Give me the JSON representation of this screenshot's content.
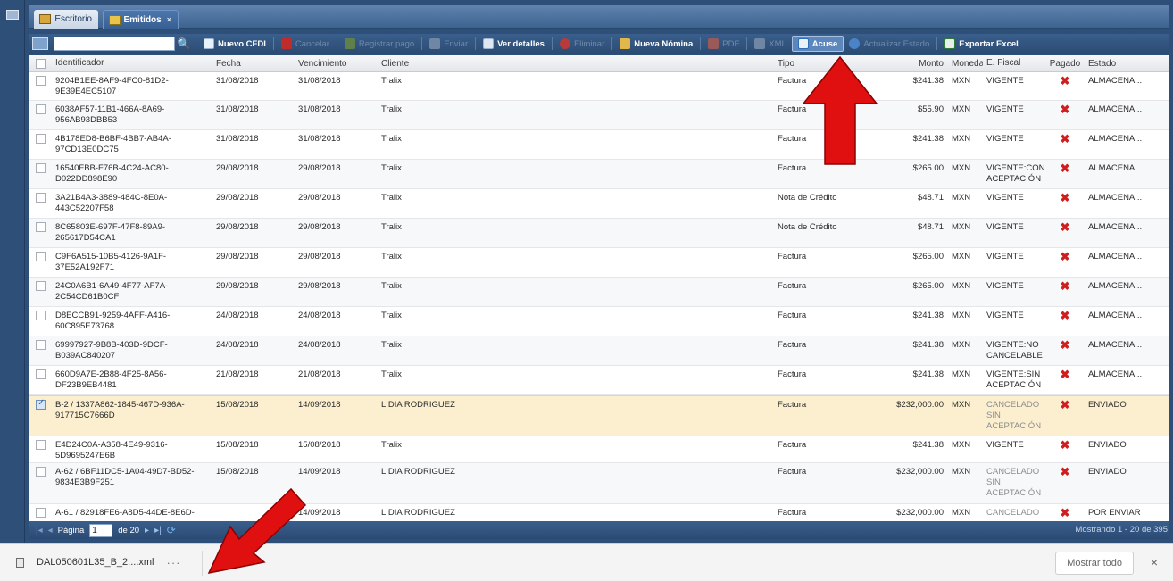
{
  "tabs": [
    {
      "label": "Escritorio",
      "icon": "desktop-icon"
    },
    {
      "label": "Emitidos",
      "icon": "documents-icon",
      "close": "×"
    }
  ],
  "toolbar": {
    "search_placeholder": "",
    "buttons": [
      {
        "label": "Nuevo CFDI",
        "icon": "new-document-icon",
        "enabled": true
      },
      {
        "label": "Cancelar",
        "icon": "cancel-icon",
        "enabled": false
      },
      {
        "label": "Registrar pago",
        "icon": "payment-icon",
        "enabled": false
      },
      {
        "label": "Enviar",
        "icon": "send-icon",
        "enabled": false
      },
      {
        "label": "Ver detalles",
        "icon": "details-icon",
        "enabled": true
      },
      {
        "label": "Eliminar",
        "icon": "delete-icon",
        "enabled": false
      },
      {
        "label": "Nueva Nómina",
        "icon": "payroll-icon",
        "enabled": true
      },
      {
        "label": "PDF",
        "icon": "pdf-icon",
        "enabled": false
      },
      {
        "label": "XML",
        "icon": "xml-icon",
        "enabled": false
      },
      {
        "label": "Acuse",
        "icon": "receipt-icon",
        "enabled": true,
        "active": true
      },
      {
        "label": "Actualizar Estado",
        "icon": "refresh-status-icon",
        "enabled": false
      },
      {
        "label": "Exportar Excel",
        "icon": "excel-icon",
        "enabled": true
      }
    ]
  },
  "columns": [
    "Identificador",
    "Fecha",
    "Vencimiento",
    "Cliente",
    "Tipo",
    "Monto",
    "Moneda",
    "E. Fiscal",
    "Pagado",
    "Estado"
  ],
  "rows": [
    {
      "id": "9204B1EE-8AF9-4FC0-81D2-9E39E4EC5107",
      "fecha": "31/08/2018",
      "venc": "31/08/2018",
      "cliente": "Tralix",
      "tipo": "Factura",
      "monto": "$241.38",
      "moneda": "MXN",
      "fiscal": "VIGENTE",
      "pagado": "✖",
      "estado": "ALMACENA...",
      "checked": false
    },
    {
      "id": "6038AF57-11B1-466A-8A69-956AB93DBB53",
      "fecha": "31/08/2018",
      "venc": "31/08/2018",
      "cliente": "Tralix",
      "tipo": "Factura",
      "monto": "$55.90",
      "moneda": "MXN",
      "fiscal": "VIGENTE",
      "pagado": "✖",
      "estado": "ALMACENA...",
      "checked": false
    },
    {
      "id": "4B178ED8-B6BF-4BB7-AB4A-97CD13E0DC75",
      "fecha": "31/08/2018",
      "venc": "31/08/2018",
      "cliente": "Tralix",
      "tipo": "Factura",
      "monto": "$241.38",
      "moneda": "MXN",
      "fiscal": "VIGENTE",
      "pagado": "✖",
      "estado": "ALMACENA...",
      "checked": false
    },
    {
      "id": "16540FBB-F76B-4C24-AC80-D022DD898E90",
      "fecha": "29/08/2018",
      "venc": "29/08/2018",
      "cliente": "Tralix",
      "tipo": "Factura",
      "monto": "$265.00",
      "moneda": "MXN",
      "fiscal": "VIGENTE:CON ACEPTACIÓN",
      "pagado": "✖",
      "estado": "ALMACENA...",
      "checked": false
    },
    {
      "id": "3A21B4A3-3889-484C-8E0A-443C52207F58",
      "fecha": "29/08/2018",
      "venc": "29/08/2018",
      "cliente": "Tralix",
      "tipo": "Nota de Crédito",
      "monto": "$48.71",
      "moneda": "MXN",
      "fiscal": "VIGENTE",
      "pagado": "✖",
      "estado": "ALMACENA...",
      "checked": false
    },
    {
      "id": "8C65803E-697F-47F8-89A9-265617D54CA1",
      "fecha": "29/08/2018",
      "venc": "29/08/2018",
      "cliente": "Tralix",
      "tipo": "Nota de Crédito",
      "monto": "$48.71",
      "moneda": "MXN",
      "fiscal": "VIGENTE",
      "pagado": "✖",
      "estado": "ALMACENA...",
      "checked": false
    },
    {
      "id": "C9F6A515-10B5-4126-9A1F-37E52A192F71",
      "fecha": "29/08/2018",
      "venc": "29/08/2018",
      "cliente": "Tralix",
      "tipo": "Factura",
      "monto": "$265.00",
      "moneda": "MXN",
      "fiscal": "VIGENTE",
      "pagado": "✖",
      "estado": "ALMACENA...",
      "checked": false
    },
    {
      "id": "24C0A6B1-6A49-4F77-AF7A-2C54CD61B0CF",
      "fecha": "29/08/2018",
      "venc": "29/08/2018",
      "cliente": "Tralix",
      "tipo": "Factura",
      "monto": "$265.00",
      "moneda": "MXN",
      "fiscal": "VIGENTE",
      "pagado": "✖",
      "estado": "ALMACENA...",
      "checked": false
    },
    {
      "id": "D8ECCB91-9259-4AFF-A416-60C895E73768",
      "fecha": "24/08/2018",
      "venc": "24/08/2018",
      "cliente": "Tralix",
      "tipo": "Factura",
      "monto": "$241.38",
      "moneda": "MXN",
      "fiscal": "VIGENTE",
      "pagado": "✖",
      "estado": "ALMACENA...",
      "checked": false
    },
    {
      "id": "69997927-9B8B-403D-9DCF-B039AC840207",
      "fecha": "24/08/2018",
      "venc": "24/08/2018",
      "cliente": "Tralix",
      "tipo": "Factura",
      "monto": "$241.38",
      "moneda": "MXN",
      "fiscal": "VIGENTE:NO CANCELABLE",
      "pagado": "✖",
      "estado": "ALMACENA...",
      "checked": false
    },
    {
      "id": "660D9A7E-2B88-4F25-8A56-DF23B9EB4481",
      "fecha": "21/08/2018",
      "venc": "21/08/2018",
      "cliente": "Tralix",
      "tipo": "Factura",
      "monto": "$241.38",
      "moneda": "MXN",
      "fiscal": "VIGENTE:SIN ACEPTACIÓN",
      "pagado": "✖",
      "estado": "ALMACENA...",
      "checked": false
    },
    {
      "id": "B-2 / 1337A862-1845-467D-936A-917715C7666D",
      "fecha": "15/08/2018",
      "venc": "14/09/2018",
      "cliente": "LIDIA RODRIGUEZ",
      "tipo": "Factura",
      "monto": "$232,000.00",
      "moneda": "MXN",
      "fiscal": "CANCELADO SIN ACEPTACIÓN",
      "pagado": "✖",
      "estado": "ENVIADO",
      "checked": true
    },
    {
      "id": "E4D24C0A-A358-4E49-9316-5D9695247E6B",
      "fecha": "15/08/2018",
      "venc": "15/08/2018",
      "cliente": "Tralix",
      "tipo": "Factura",
      "monto": "$241.38",
      "moneda": "MXN",
      "fiscal": "VIGENTE",
      "pagado": "✖",
      "estado": "ENVIADO",
      "checked": false
    },
    {
      "id": "A-62 / 6BF11DC5-1A04-49D7-BD52-9834E3B9F251",
      "fecha": "15/08/2018",
      "venc": "14/09/2018",
      "cliente": "LIDIA RODRIGUEZ",
      "tipo": "Factura",
      "monto": "$232,000.00",
      "moneda": "MXN",
      "fiscal": "CANCELADO SIN ACEPTACIÓN",
      "pagado": "✖",
      "estado": "ENVIADO",
      "checked": false
    },
    {
      "id": "A-61 / 82918FE6-A8D5-44DE-8E6D-",
      "fecha": "",
      "venc": "14/09/2018",
      "cliente": "LIDIA RODRIGUEZ",
      "tipo": "Factura",
      "monto": "$232,000.00",
      "moneda": "MXN",
      "fiscal": "CANCELADO",
      "pagado": "✖",
      "estado": "POR ENVIAR",
      "checked": false
    }
  ],
  "pager": {
    "page_label": "Página",
    "page_value": "1",
    "of_label": "de 20",
    "summary": "Mostrando 1 - 20 de 395"
  },
  "downloads": {
    "file_name": "DAL050601L35_B_2....xml",
    "more": "···",
    "show_all": "Mostrar todo",
    "close": "×"
  },
  "colors": {
    "frame": "#2e4f78",
    "selected_row": "#fbefcf",
    "unpaid_mark": "#d01e1e",
    "annotation_arrow": "#e01010"
  }
}
